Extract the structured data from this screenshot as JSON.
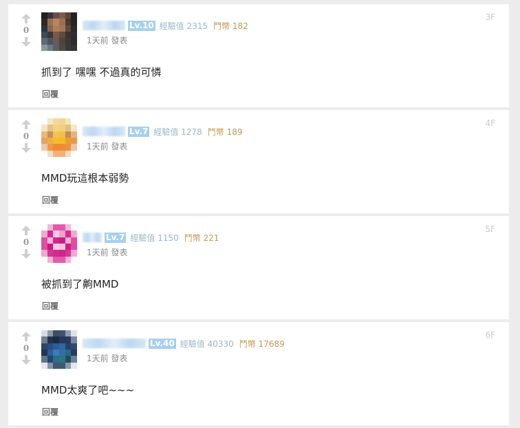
{
  "comments": [
    {
      "votes": "0",
      "level": "Lv.10",
      "exp": "經驗值 2315",
      "coins": "鬥幣 182",
      "time": "1天前 發表",
      "floor": "3F",
      "text": "抓到了 嘿嘿 不過真的可憐",
      "reply": "回覆",
      "avatar": [
        "#1f1f1f",
        "#3b3331",
        "#645049",
        "#7a5d4d",
        "#5a4539",
        "#232323",
        "#2c2926",
        "#9a6f4e",
        "#b7865f",
        "#9b7054",
        "#4b3a30",
        "#252525",
        "#2a3340",
        "#8a664e",
        "#b27e5a",
        "#a27459",
        "#5b4a3d",
        "#2a2a2a",
        "#3c4a58",
        "#3d3433",
        "#7a5a46",
        "#5f4b3e",
        "#3a3330",
        "#2e2e2e",
        "#5d6b73",
        "#4b5260",
        "#6b5a52",
        "#4c4541",
        "#3b3834",
        "#2c2c2c",
        "#8e9797",
        "#6c7a84",
        "#5a5f62",
        "#4c4a47",
        "#3a3938",
        "#333333"
      ]
    },
    {
      "votes": "0",
      "level": "Lv.7",
      "exp": "經驗值 1278",
      "coins": "鬥幣 189",
      "time": "1天前 發表",
      "floor": "4F",
      "text": "MMD玩這根本弱勢",
      "reply": "回覆",
      "avatar": [
        "#ffffff",
        "#f6e7c8",
        "#f4d89a",
        "#f2d393",
        "#f4e3bd",
        "#ffffff",
        "#f6e3c1",
        "#e7c281",
        "#f3d47e",
        "#f1d07d",
        "#e3bf84",
        "#f6e6c6",
        "#e9b977",
        "#c78d63",
        "#f2c44f",
        "#efbf4a",
        "#c48a5d",
        "#e4b679",
        "#e3a561",
        "#f0b03a",
        "#f6bc2d",
        "#f5b92d",
        "#ee9f2c",
        "#e29b55",
        "#f1c8a1",
        "#ec9a49",
        "#ee8c2a",
        "#ef8d2c",
        "#e9914b",
        "#efc49e",
        "#ffffff",
        "#f6dcc4",
        "#f0b27d",
        "#f0b37f",
        "#f6dbc3",
        "#ffffff"
      ]
    },
    {
      "votes": "0",
      "level": "Lv.7",
      "exp": "經驗值 1150",
      "coins": "鬥幣 221",
      "time": "1天前 發表",
      "floor": "5F",
      "text": "被抓到了齁MMD",
      "reply": "回覆",
      "avatar": [
        "#ffffff",
        "#f2b6d8",
        "#e45aa9",
        "#e35ba8",
        "#f2b9d9",
        "#ffffff",
        "#f0a9d0",
        "#d8288f",
        "#f7c9e3",
        "#f0a4cf",
        "#d62b8f",
        "#f0aad0",
        "#e24fa2",
        "#f4b7da",
        "#d3278a",
        "#c81f7f",
        "#f1b1d6",
        "#e14ea1",
        "#df4b9f",
        "#c51b7c",
        "#f7cde5",
        "#f5c2df",
        "#c81f80",
        "#df4b9f",
        "#f0a8cf",
        "#d83293",
        "#d22b8b",
        "#cd2686",
        "#d93596",
        "#f0a9d0",
        "#ffffff",
        "#f2b4d7",
        "#e45aa9",
        "#e45aa9",
        "#f2b4d7",
        "#ffffff"
      ]
    },
    {
      "votes": "0",
      "level": "Lv.40",
      "exp": "經驗值 40330",
      "coins": "鬥幣 17689",
      "time": "1天前 發表",
      "floor": "6F",
      "text": "MMD太爽了吧~~~",
      "reply": "回覆",
      "avatar": [
        "#d8dde3",
        "#8d99a8",
        "#3c4d63",
        "#40526b",
        "#8f9cae",
        "#dfe3e7",
        "#6f7f93",
        "#23324a",
        "#1c2a44",
        "#26385a",
        "#2a3b5a",
        "#7c8aa0",
        "#2e4566",
        "#2a4f7e",
        "#2d5d93",
        "#3166a0",
        "#23436d",
        "#34496a",
        "#1f3555",
        "#2b5f96",
        "#3a7bb8",
        "#2f6ea6",
        "#276b7f",
        "#243c5c",
        "#5f7590",
        "#23466b",
        "#2c6d87",
        "#2d7482",
        "#27495e",
        "#6a7e94",
        "#e3e7eb",
        "#8596aa",
        "#415873",
        "#3f5870",
        "#8b9aab",
        "#e2e6ea"
      ]
    }
  ]
}
